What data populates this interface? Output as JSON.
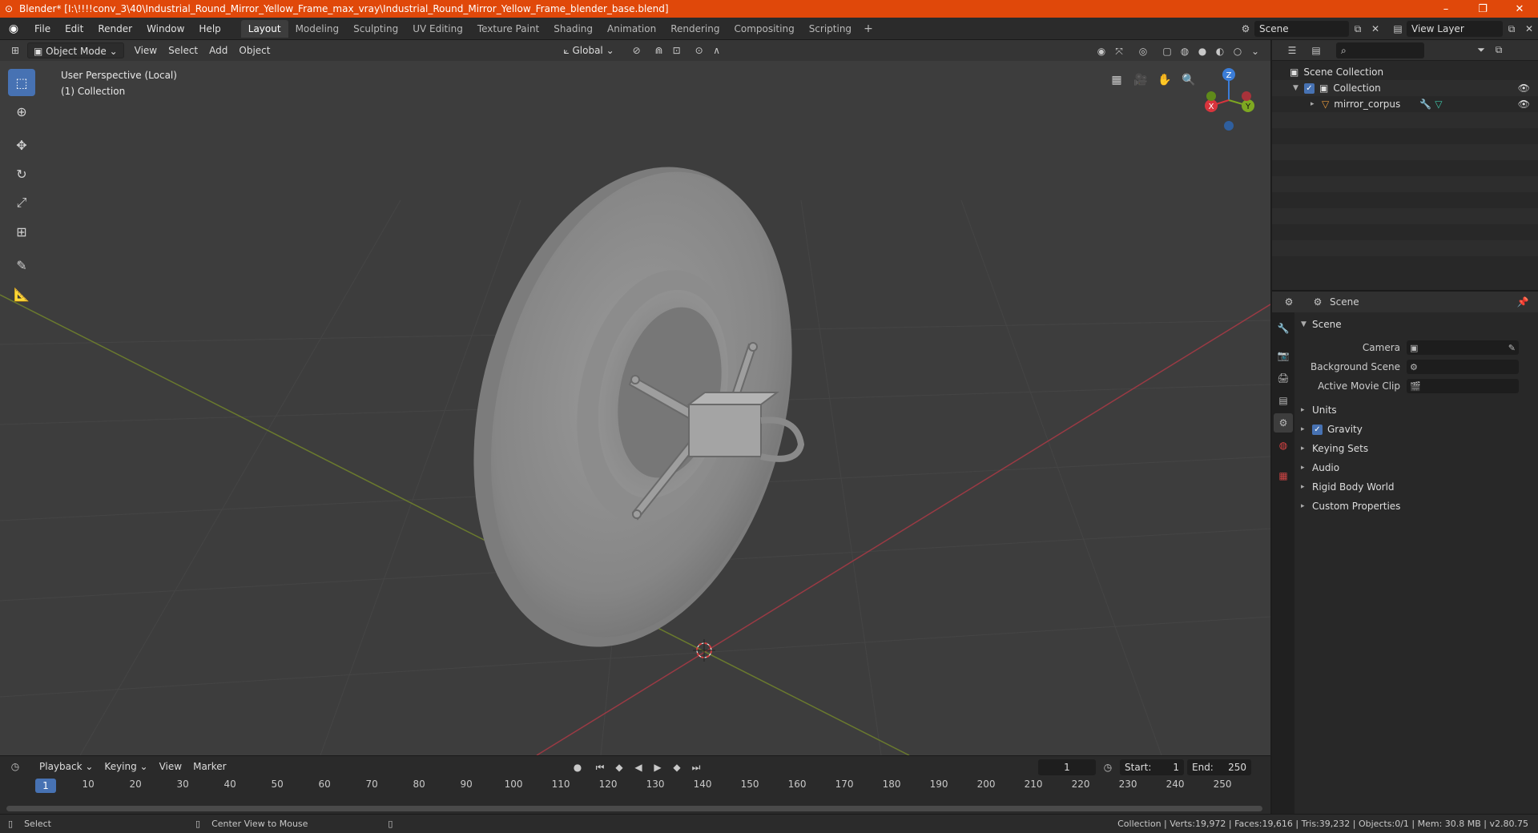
{
  "window": {
    "title": "Blender* [I:\\!!!!conv_3\\40\\Industrial_Round_Mirror_Yellow_Frame_max_vray\\Industrial_Round_Mirror_Yellow_Frame_blender_base.blend]",
    "minimize": "–",
    "maximize": "❐",
    "close": "✕"
  },
  "menu": [
    "File",
    "Edit",
    "Render",
    "Window",
    "Help"
  ],
  "workspaces": [
    {
      "label": "Layout",
      "active": true
    },
    {
      "label": "Modeling"
    },
    {
      "label": "Sculpting"
    },
    {
      "label": "UV Editing"
    },
    {
      "label": "Texture Paint"
    },
    {
      "label": "Shading"
    },
    {
      "label": "Animation"
    },
    {
      "label": "Rendering"
    },
    {
      "label": "Compositing"
    },
    {
      "label": "Scripting"
    }
  ],
  "workspace_add": "+",
  "scene_selector": "Scene",
  "view_layer_selector": "View Layer",
  "viewport": {
    "mode": "Object Mode",
    "menus": [
      "View",
      "Select",
      "Add",
      "Object"
    ],
    "transform_orientation": "Global",
    "info_line1": "User Perspective (Local)",
    "info_line2": "(1) Collection",
    "gizmo": {
      "x": "X",
      "y": "Y",
      "z": "Z"
    }
  },
  "timeline": {
    "menus": [
      "Playback",
      "Keying",
      "View",
      "Marker"
    ],
    "current_frame": "1",
    "start_label": "Start:",
    "start": "1",
    "end_label": "End:",
    "end": "250",
    "ticks": [
      "10",
      "20",
      "30",
      "40",
      "50",
      "60",
      "70",
      "80",
      "90",
      "100",
      "110",
      "120",
      "130",
      "140",
      "150",
      "160",
      "170",
      "180",
      "190",
      "200",
      "210",
      "220",
      "230",
      "240",
      "250"
    ],
    "cursor_label": "1"
  },
  "outliner": {
    "root": "Scene Collection",
    "collection": "Collection",
    "object": "mirror_corpus"
  },
  "properties": {
    "header": "Scene",
    "panel": "Scene",
    "camera_label": "Camera",
    "background_scene_label": "Background Scene",
    "active_movie_clip_label": "Active Movie Clip",
    "subpanels": [
      "Units",
      "Gravity",
      "Keying Sets",
      "Audio",
      "Rigid Body World",
      "Custom Properties"
    ]
  },
  "status": {
    "select": "Select",
    "center_view": "Center View to Mouse",
    "stats": "Collection | Verts:19,972 | Faces:19,616 | Tris:39,232 | Objects:0/1 | Mem: 30.8 MB | v2.80.75"
  }
}
